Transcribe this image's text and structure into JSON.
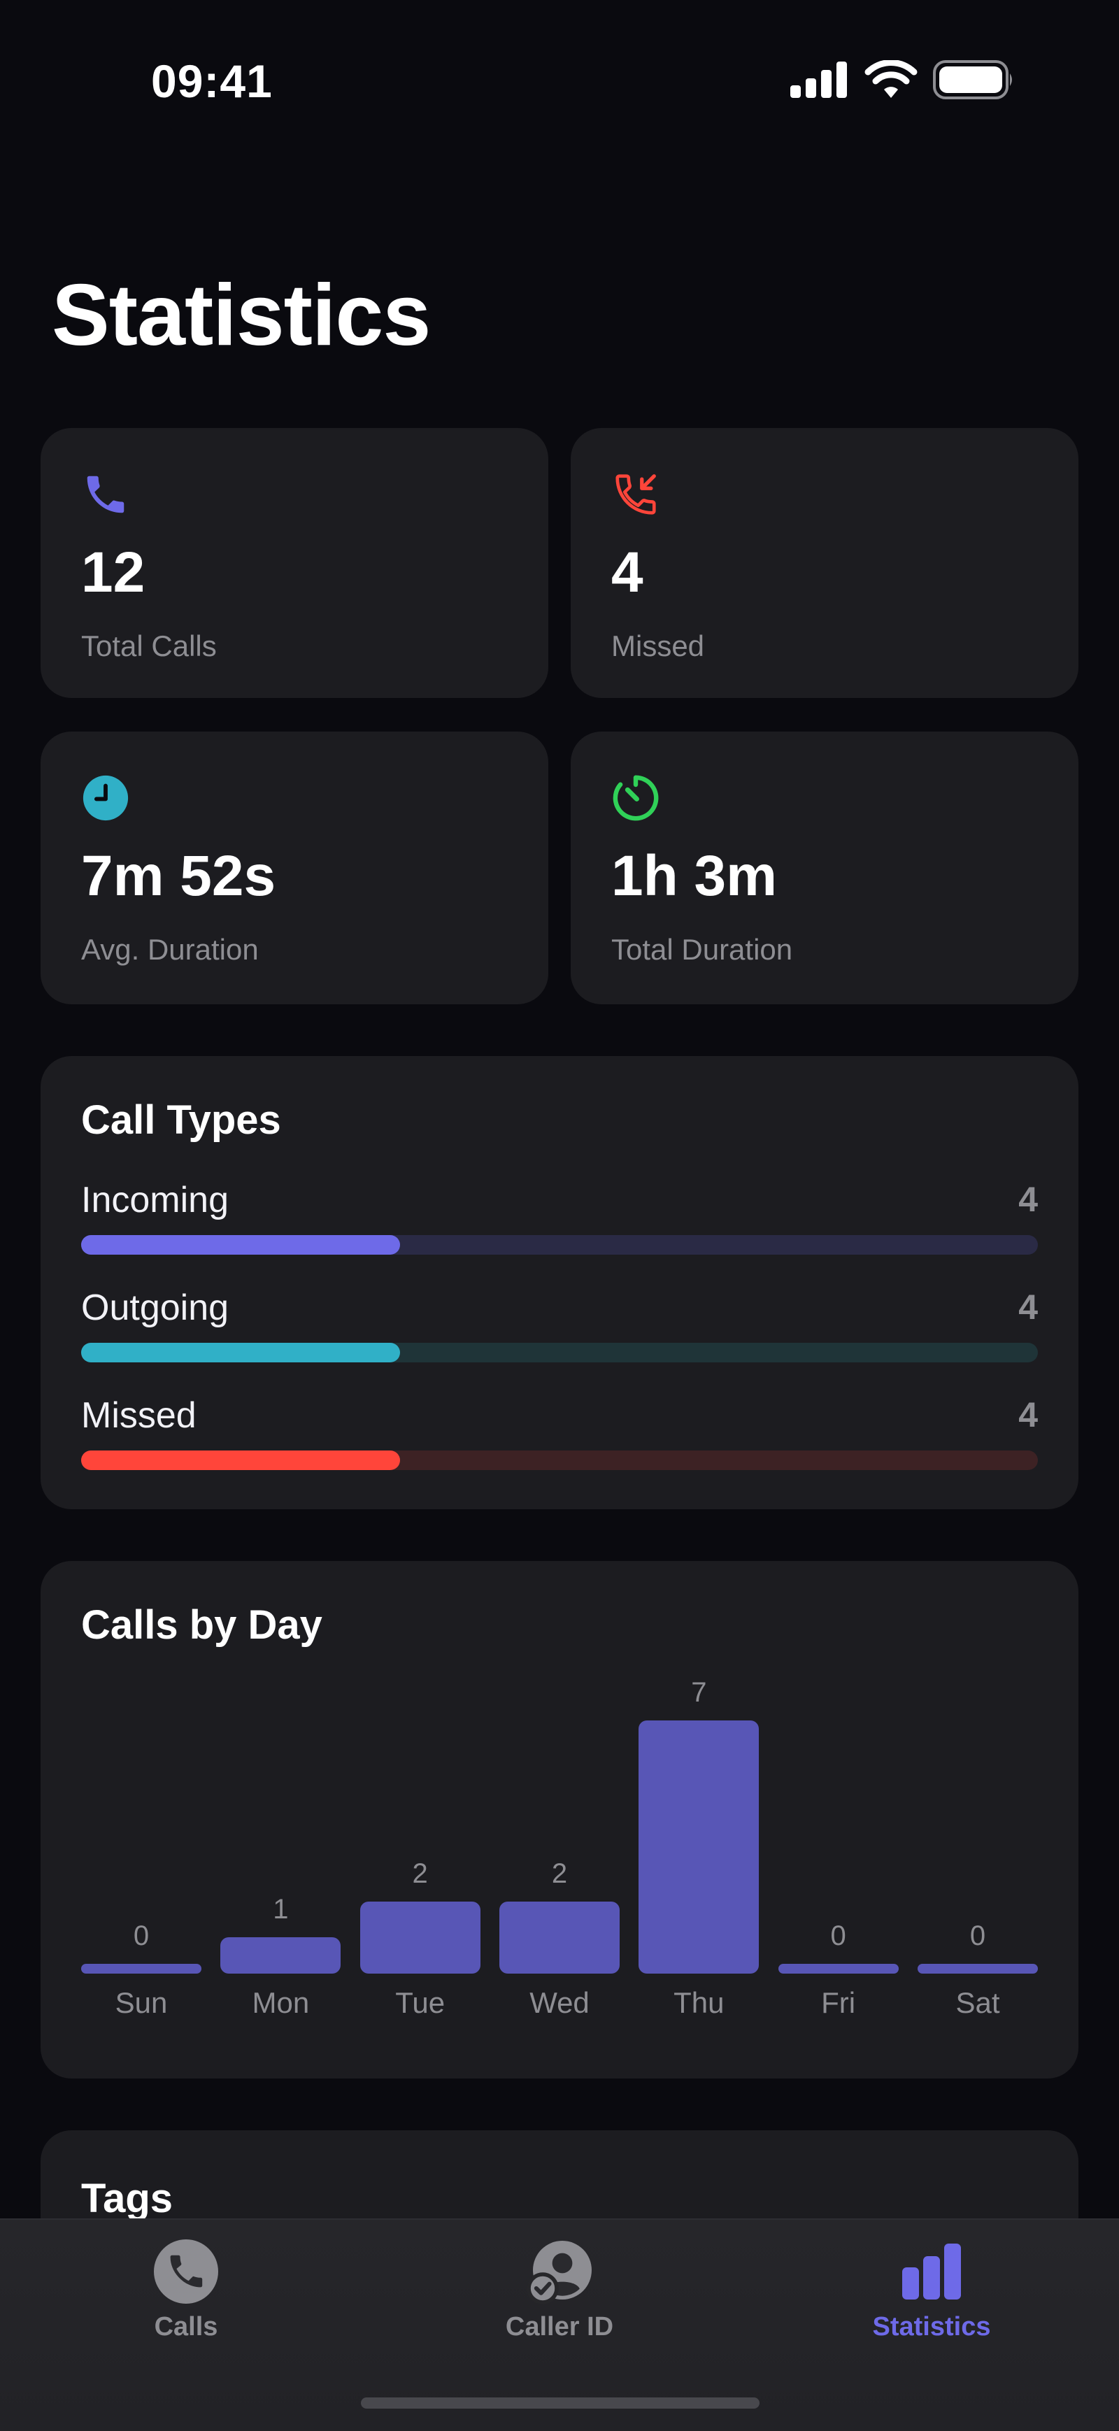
{
  "status_bar": {
    "time": "09:41"
  },
  "page": {
    "title": "Statistics"
  },
  "stats": [
    {
      "value": "12",
      "label": "Total Calls",
      "icon": "phone-icon",
      "color": "#6e6ae8"
    },
    {
      "value": "4",
      "label": "Missed",
      "icon": "missed-call-icon",
      "color": "#ff453a"
    },
    {
      "value": "7m 52s",
      "label": "Avg. Duration",
      "icon": "clock-icon",
      "color": "#30b0c7"
    },
    {
      "value": "1h 3m",
      "label": "Total Duration",
      "icon": "timer-icon",
      "color": "#30d158"
    }
  ],
  "call_types": {
    "title": "Call Types",
    "items": [
      {
        "label": "Incoming",
        "count": "4",
        "fraction": 0.333,
        "color": "#6e6ae8",
        "track": "#2a2a45"
      },
      {
        "label": "Outgoing",
        "count": "4",
        "fraction": 0.333,
        "color": "#30b0c7",
        "track": "#1f3438"
      },
      {
        "label": "Missed",
        "count": "4",
        "fraction": 0.333,
        "color": "#ff453a",
        "track": "#3d2224"
      }
    ]
  },
  "calls_by_day": {
    "title": "Calls by Day",
    "days": [
      {
        "day": "Sun",
        "value": 0
      },
      {
        "day": "Mon",
        "value": 1
      },
      {
        "day": "Tue",
        "value": 2
      },
      {
        "day": "Wed",
        "value": 2
      },
      {
        "day": "Thu",
        "value": 7
      },
      {
        "day": "Fri",
        "value": 0
      },
      {
        "day": "Sat",
        "value": 0
      }
    ],
    "max": 7,
    "bar_color": "#5856b6"
  },
  "tags": {
    "title": "Tags"
  },
  "tabbar": {
    "tabs": [
      {
        "label": "Calls",
        "icon": "phone-circle-icon",
        "active": false
      },
      {
        "label": "Caller ID",
        "icon": "person-check-icon",
        "active": false
      },
      {
        "label": "Statistics",
        "icon": "bar-chart-icon",
        "active": true
      }
    ],
    "active_color": "#6e6ae8"
  }
}
